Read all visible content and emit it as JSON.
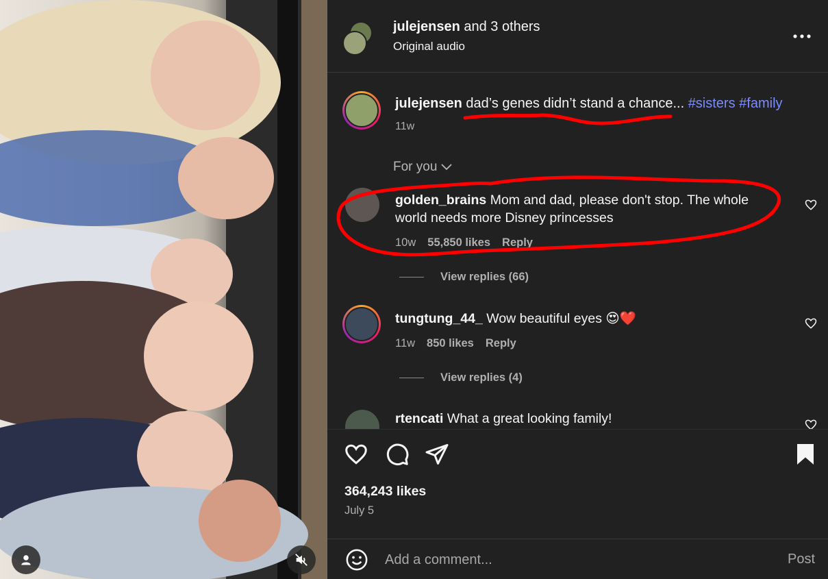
{
  "header": {
    "username": "julejensen",
    "others": " and 3 others",
    "audio": "Original audio"
  },
  "caption": {
    "username": "julejensen",
    "text": " dad’s genes didn’t stand a chance... ",
    "tag1": "#sisters",
    "tag2": "#family",
    "time": "11w"
  },
  "comments_filter": "For you",
  "comments": [
    {
      "username": "golden_brains",
      "text": " Mom and dad, please don't stop. The whole world needs more Disney princesses",
      "time": "10w",
      "likes": "55,850 likes",
      "reply": "Reply",
      "view_replies": "View replies (66)"
    },
    {
      "username": "tungtung_44_",
      "text": " Wow beautiful eyes 😍❤️",
      "time": "11w",
      "likes": "850 likes",
      "reply": "Reply",
      "view_replies": "View replies (4)"
    },
    {
      "username": "rtencati",
      "text": " What a great looking family!"
    }
  ],
  "post": {
    "likes": "364,243 likes",
    "date": "July 5"
  },
  "compose": {
    "placeholder": "Add a comment...",
    "post_label": "Post"
  },
  "icons": {
    "more": "more-options-icon",
    "like": "heart-icon",
    "comment": "comment-icon",
    "share": "share-icon",
    "save": "bookmark-icon",
    "emoji": "emoji-icon",
    "mute": "muted-speaker-icon",
    "user": "user-icon"
  },
  "colors": {
    "panel_bg": "#212121",
    "hashtag": "#7b8cff",
    "annotation": "#ff0000"
  }
}
